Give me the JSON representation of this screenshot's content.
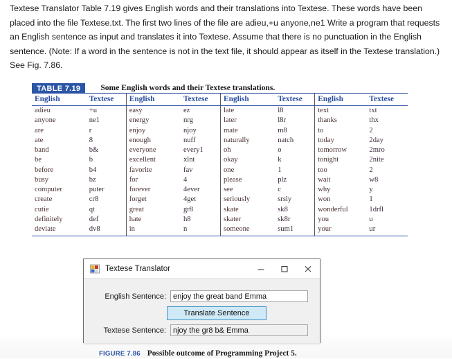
{
  "intro": {
    "paragraph": "Textese Translator Table 7.19 gives English words and their translations into Textese. These words have been placed into the file Textese.txt. The first two lines of the file are adieu,+u anyone,ne1 Write a program that requests an English sentence as input and translates it into Textese. Assume that there is no punctuation in the English sentence. (Note: If a word in the sentence is not in the text file, it should appear as itself in the Textese translation.) See Fig. 7.86."
  },
  "table": {
    "badge": "TABLE 7.19",
    "caption": "Some English words and their Textese translations.",
    "headers": [
      "English",
      "Textese",
      "English",
      "Textese",
      "English",
      "Textese",
      "English",
      "Textese"
    ],
    "rows": [
      [
        "adieu",
        "+u",
        "easy",
        "ez",
        "late",
        "l8",
        "text",
        "txt"
      ],
      [
        "anyone",
        "ne1",
        "energy",
        "nrg",
        "later",
        "l8r",
        "thanks",
        "thx"
      ],
      [
        "are",
        "r",
        "enjoy",
        "njoy",
        "mate",
        "m8",
        "to",
        "2"
      ],
      [
        "ate",
        "8",
        "enough",
        "nuff",
        "naturally",
        "natch",
        "today",
        "2day"
      ],
      [
        "band",
        "b&",
        "everyone",
        "every1",
        "oh",
        "o",
        "tomorrow",
        "2mro"
      ],
      [
        "be",
        "b",
        "excellent",
        "xlnt",
        "okay",
        "k",
        "tonight",
        "2nite"
      ],
      [
        "before",
        "b4",
        "favorite",
        "fav",
        "one",
        "1",
        "too",
        "2"
      ],
      [
        "busy",
        "bz",
        "for",
        "4",
        "please",
        "plz",
        "wait",
        "w8"
      ],
      [
        "computer",
        "puter",
        "forever",
        "4ever",
        "see",
        "c",
        "why",
        "y"
      ],
      [
        "create",
        "cr8",
        "forget",
        "4get",
        "seriously",
        "srsly",
        "won",
        "1"
      ],
      [
        "cutie",
        "qt",
        "great",
        "gr8",
        "skate",
        "sk8",
        "wonderful",
        "1drfl"
      ],
      [
        "definitely",
        "def",
        "hate",
        "h8",
        "skater",
        "sk8r",
        "you",
        "u"
      ],
      [
        "deviate",
        "dv8",
        "in",
        "n",
        "someone",
        "sum1",
        "your",
        "ur"
      ]
    ]
  },
  "dialog": {
    "title": "Textese Translator",
    "icon": "winforms-app-icon",
    "minimize_label": "minimize-icon",
    "maximize_label": "maximize-icon",
    "close_label": "close-icon",
    "english_label": "English Sentence:",
    "english_value": "enjoy the great band Emma",
    "english_placeholder": "",
    "translate_button": "Translate Sentence",
    "textese_label": "Textese Sentence:",
    "textese_value": "njoy the gr8 b& Emma",
    "textese_placeholder": ""
  },
  "figure": {
    "label": "FIGURE 7.86",
    "text": "Possible outcome of Programming Project 5."
  },
  "colors": {
    "accent_blue": "#2b55a6",
    "badge_bg": "#2b55a6",
    "button_bg": "#cfe9f7",
    "button_border": "#3c93c2",
    "table_text": "#3a2a2a"
  }
}
